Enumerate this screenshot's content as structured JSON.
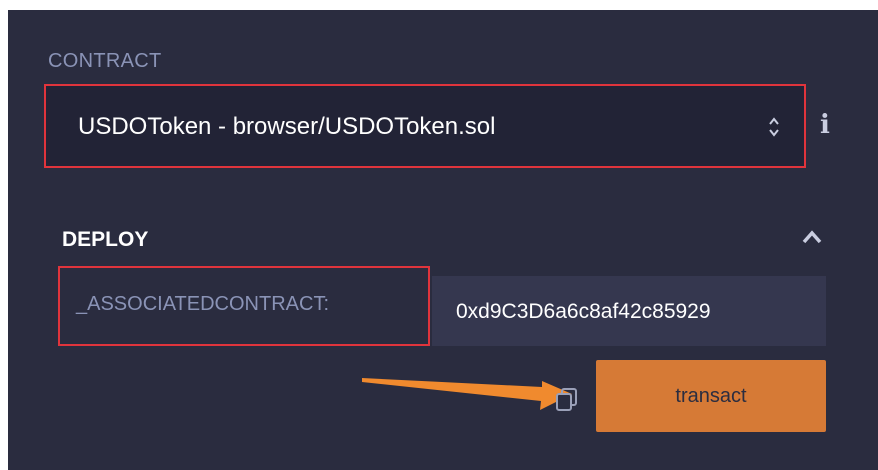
{
  "contract_section": {
    "label": "CONTRACT",
    "selected_contract": "USDOToken - browser/USDOToken.sol",
    "info_icon": "info-icon",
    "select_icon": "up-down-chevron-icon"
  },
  "deploy_section": {
    "title": "DEPLOY",
    "collapse_icon": "chevron-up-icon",
    "parameter": {
      "label": "_ASSOCIATEDCONTRACT:",
      "value": "0xd9C3D6a6c8af42c85929"
    },
    "copy_icon": "copy-icon",
    "transact_label": "transact"
  },
  "annotations": {
    "highlight_color": "#e0343c",
    "arrow_color": "#f08a2e"
  },
  "colors": {
    "panel_bg": "#2a2c3f",
    "input_bg": "#35374f",
    "button_bg": "#d67a36"
  }
}
